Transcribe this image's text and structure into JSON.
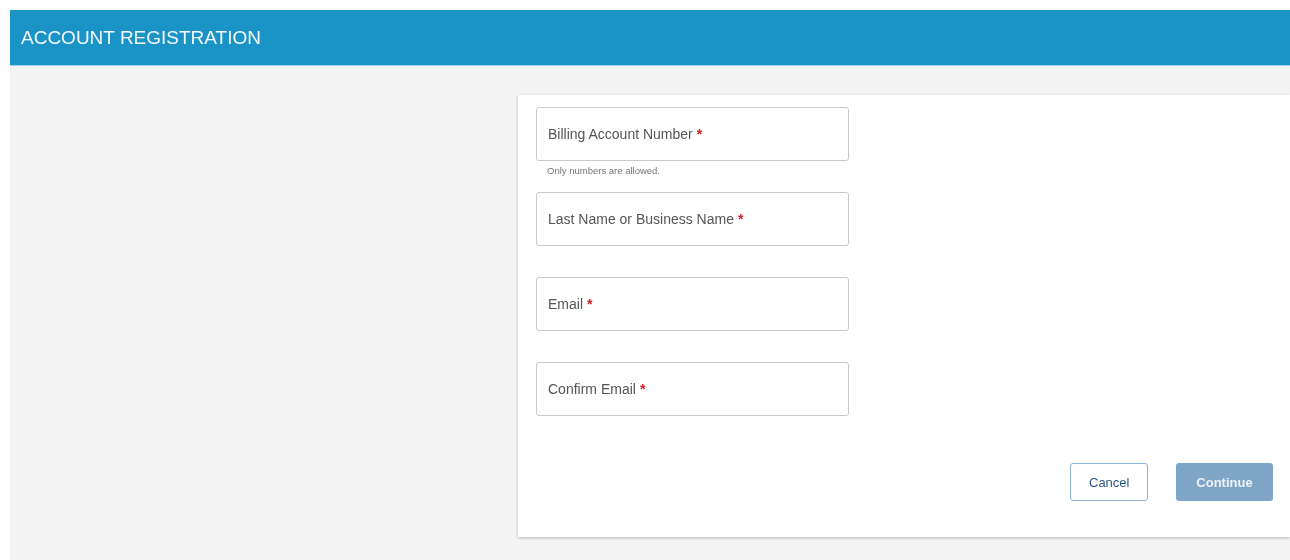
{
  "header": {
    "title": "ACCOUNT REGISTRATION"
  },
  "required_mark": "*",
  "fields": [
    {
      "label": "Billing Account Number",
      "required": true,
      "hint": "Only numbers are allowed."
    },
    {
      "label": "Last Name or Business Name",
      "required": true
    },
    {
      "label": "Email",
      "required": true
    },
    {
      "label": "Confirm Email",
      "required": true
    }
  ],
  "buttons": [
    {
      "label": "Cancel",
      "kind": "secondary",
      "disabled": false
    },
    {
      "label": "Continue",
      "kind": "primary",
      "disabled": true
    }
  ]
}
